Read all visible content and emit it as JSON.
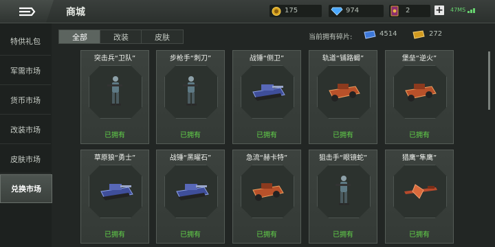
{
  "header": {
    "title": "商城",
    "gold": "175",
    "diamonds": "974",
    "cards": "2",
    "ping": "47MS"
  },
  "sidebar": {
    "items": [
      {
        "label": "特供礼包"
      },
      {
        "label": "军需市场"
      },
      {
        "label": "货币市场"
      },
      {
        "label": "改装市场"
      },
      {
        "label": "皮肤市场"
      },
      {
        "label": "兑换市场"
      }
    ],
    "active_index": 5
  },
  "tabs": [
    {
      "label": "全部"
    },
    {
      "label": "改装"
    },
    {
      "label": "皮肤"
    }
  ],
  "fragments": {
    "label": "当前拥有碎片:",
    "blue": "4514",
    "gold": "272"
  },
  "cards": [
    {
      "name": "突击兵“卫队”",
      "status": "已拥有",
      "icon": "soldier-icon"
    },
    {
      "name": "步枪手“刺刀”",
      "status": "已拥有",
      "icon": "soldier-icon"
    },
    {
      "name": "战锤“侧卫”",
      "status": "已拥有",
      "icon": "tank-icon"
    },
    {
      "name": "轨道“铺路蝎”",
      "status": "已拥有",
      "icon": "vehicle-icon"
    },
    {
      "name": "堡垒“逆火”",
      "status": "已拥有",
      "icon": "vehicle-icon"
    },
    {
      "name": "草原狼“勇士”",
      "status": "已拥有",
      "icon": "tank-icon"
    },
    {
      "name": "战锤“黑曜石”",
      "status": "已拥有",
      "icon": "tank-icon"
    },
    {
      "name": "急流“赫卡特”",
      "status": "已拥有",
      "icon": "vehicle-icon"
    },
    {
      "name": "狙击手“眼镜蛇”",
      "status": "已拥有",
      "icon": "soldier-icon"
    },
    {
      "name": "猎鹰“隼鹰”",
      "status": "已拥有",
      "icon": "aircraft-icon"
    }
  ]
}
